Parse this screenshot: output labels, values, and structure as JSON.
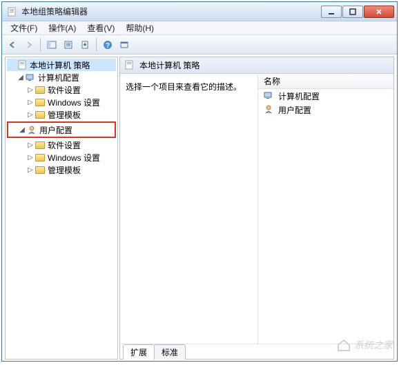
{
  "window": {
    "title": "本地组策略编辑器"
  },
  "menubar": [
    "文件(F)",
    "操作(A)",
    "查看(V)",
    "帮助(H)"
  ],
  "tree": {
    "root": "本地计算机 策略",
    "computer": {
      "label": "计算机配置",
      "children": [
        "软件设置",
        "Windows 设置",
        "管理模板"
      ]
    },
    "user": {
      "label": "用户配置",
      "children": [
        "软件设置",
        "Windows 设置",
        "管理模板"
      ]
    }
  },
  "right": {
    "heading": "本地计算机 策略",
    "prompt": "选择一个项目来查看它的描述。",
    "column": "名称",
    "items": [
      "计算机配置",
      "用户配置"
    ]
  },
  "tabs": {
    "extended": "扩展",
    "standard": "标准"
  },
  "watermark": "系统之家"
}
